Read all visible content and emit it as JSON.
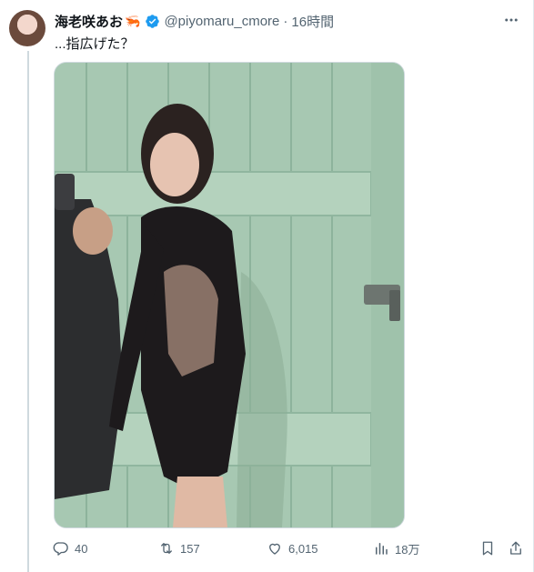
{
  "tweet": {
    "author": {
      "display_name": "海老咲あお",
      "emoji": "🦐",
      "handle": "@piyomaru_cmore",
      "verified": true
    },
    "separator": "·",
    "time": "16時間",
    "text": "...指広げた？",
    "media": {
      "icon": "photo",
      "alt": ""
    },
    "actions": {
      "reply_count": "40",
      "retweet_count": "157",
      "like_count": "6,015",
      "views_count": "18万"
    }
  },
  "colors": {
    "accent": "#1d9bf0",
    "text_primary": "#0f1419",
    "text_secondary": "#536471",
    "border": "#cfd9de"
  },
  "icons": [
    "avatar",
    "verified-badge-icon",
    "more-icon",
    "reply-icon",
    "retweet-icon",
    "like-icon",
    "views-icon",
    "bookmark-icon",
    "share-icon"
  ]
}
